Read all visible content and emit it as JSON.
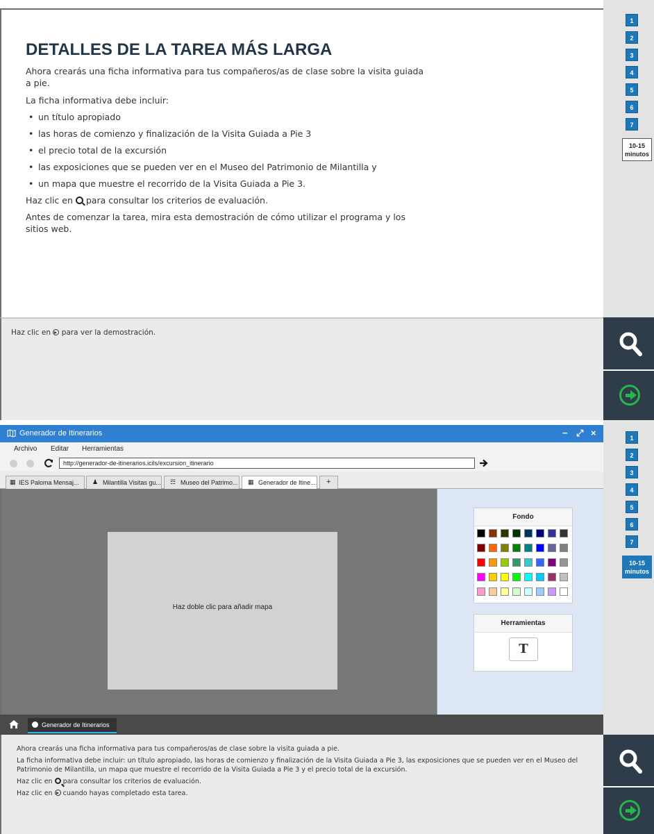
{
  "top": {
    "task": {
      "title": "DETALLES DE LA TAREA MÁS LARGA",
      "intro": "Ahora crearás una ficha informativa para tus compañeros/as de clase sobre la visita guiada a pie.",
      "include_label": "La ficha informativa debe incluir:",
      "bullets": [
        "un título apropiado",
        "las horas de comienzo y finalización de la Visita Guiada a Pie 3",
        "el precio total de la excursión",
        "las exposiciones que se pueden ver en el Museo del Patrimonio de Milantilla y",
        "un mapa que muestre el recorrido de la Visita Guiada a Pie 3."
      ],
      "search_hint_before": "Haz clic en",
      "search_hint_after": "para consultar los criterios de evaluación.",
      "demo_text": "Antes de comenzar la tarea, mira esta demostración de cómo utilizar el programa y los sitios web."
    },
    "hint_before": "Haz clic en",
    "hint_after": "para ver la demostración.",
    "steps": [
      "1",
      "2",
      "3",
      "4",
      "5",
      "6",
      "7"
    ],
    "time_label_1": "10-15",
    "time_label_2": "minutos"
  },
  "bottom": {
    "window": {
      "title": "Generador de Itinerarios",
      "minimize": "−",
      "maximize": "⤢",
      "close": "×"
    },
    "menu": [
      "Archivo",
      "Editar",
      "Herramientas"
    ],
    "url": "http://generador-de-itinerarios.icils/excursion_itinerario",
    "tabs": [
      {
        "label": "IES Paloma Mensaj...",
        "icon": "bus-icon"
      },
      {
        "label": "Milantilla Visitas gu...",
        "icon": "walker-icon"
      },
      {
        "label": "Museo del Patrimo...",
        "icon": "museum-icon"
      },
      {
        "label": "Generador de Itine...",
        "icon": "map-icon"
      }
    ],
    "new_tab": "+",
    "map_prompt": "Haz doble clic para añadir mapa",
    "fondo_title": "Fondo",
    "swatch_colors": [
      [
        "#000000",
        "#8a3300",
        "#333300",
        "#003300",
        "#003366",
        "#000080",
        "#333399",
        "#333333"
      ],
      [
        "#800000",
        "#ff6600",
        "#808000",
        "#008000",
        "#008080",
        "#0000ff",
        "#666699",
        "#808080"
      ],
      [
        "#ff0000",
        "#ff9900",
        "#99cc00",
        "#339966",
        "#33cccc",
        "#3366ff",
        "#800080",
        "#969696"
      ],
      [
        "#ff00ff",
        "#ffcc00",
        "#ffff00",
        "#00ff00",
        "#00ffff",
        "#00ccff",
        "#993366",
        "#c0c0c0"
      ],
      [
        "#ff99cc",
        "#ffcc99",
        "#ffff99",
        "#ccffcc",
        "#ccffff",
        "#99ccff",
        "#cc99ff",
        "#ffffff"
      ]
    ],
    "tools_title": "Herramientas",
    "text_tool": "T",
    "taskbar_app": "Generador de Itinerarios",
    "hint": {
      "line1": "Ahora crearás una ficha informativa para tus compañeros/as de clase sobre la visita guiada a pie.",
      "line2": "La ficha informativa debe incluir: un título apropiado, las horas de comienzo y finalización de la Visita Guiada a Pie 3, las exposiciones que se pueden ver en el Museo del Patrimonio de Milantilla, un mapa que muestre el recorrido de la Visita Guiada a Pie 3 y el precio total de la excursión.",
      "search_before": "Haz clic en",
      "search_after": "para consultar los criterios de evaluación.",
      "next_before": "Haz clic en",
      "next_after": "cuando hayas completado esta tarea."
    },
    "steps": [
      "1",
      "2",
      "3",
      "4",
      "5",
      "6",
      "7"
    ],
    "time_label_1": "10-15",
    "time_label_2": "minutos"
  },
  "colors": {
    "accent": "#1e77b7",
    "titlebar": "#2f7fd3",
    "dark_button": "#2f3d4a",
    "next_green": "#27b64a"
  }
}
